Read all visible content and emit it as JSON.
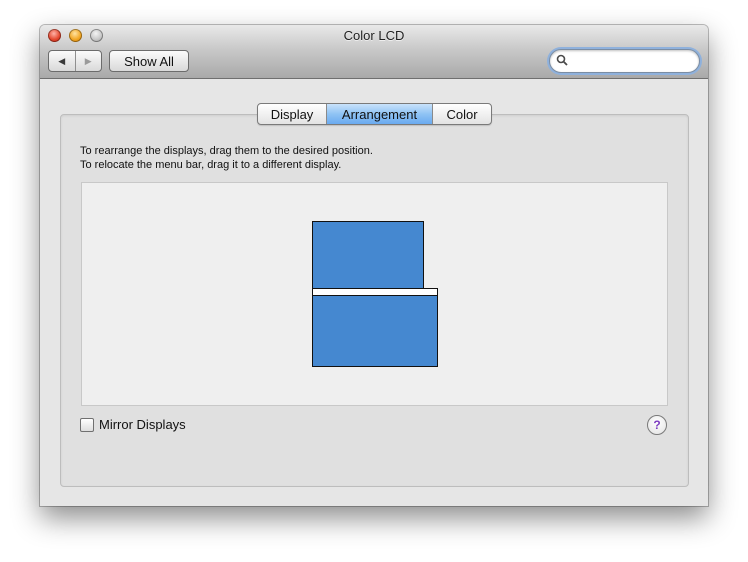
{
  "window": {
    "title": "Color LCD"
  },
  "toolbar": {
    "back_icon": "back-arrow-icon",
    "forward_icon": "forward-arrow-icon",
    "show_all_label": "Show All",
    "search_value": "",
    "search_icon": "search-icon"
  },
  "tabs": [
    {
      "label": "Display",
      "selected": false
    },
    {
      "label": "Arrangement",
      "selected": true
    },
    {
      "label": "Color",
      "selected": false
    }
  ],
  "instructions": {
    "line1": "To rearrange the displays, drag them to the desired position.",
    "line2": "To relocate the menu bar, drag it to a different display."
  },
  "mirror": {
    "label": "Mirror Displays",
    "checked": false
  },
  "help": {
    "symbol": "?"
  },
  "colors": {
    "display_fill": "#4588d0",
    "selected_tab": "#8fc3f4",
    "help_icon": "#7e3fc1"
  }
}
